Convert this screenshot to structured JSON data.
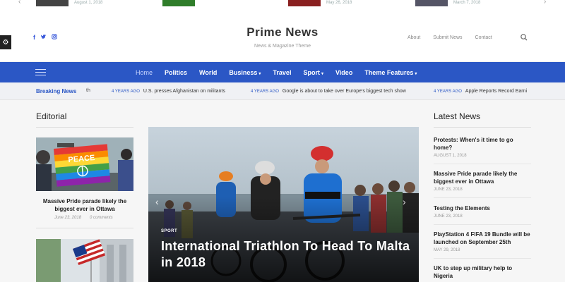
{
  "top_strip": {
    "dates": [
      "August 1, 2018",
      "May 26, 2018",
      "March 7, 2018"
    ]
  },
  "header": {
    "site_title": "Prime News",
    "tagline": "News & Magazine Theme",
    "links": [
      "About",
      "Submit News",
      "Contact"
    ]
  },
  "nav": {
    "items": [
      {
        "label": "Home",
        "caret": ""
      },
      {
        "label": "Politics",
        "caret": ""
      },
      {
        "label": "World",
        "caret": ""
      },
      {
        "label": "Business",
        "caret": "▾"
      },
      {
        "label": "Travel",
        "caret": ""
      },
      {
        "label": "Sport",
        "caret": "▾"
      },
      {
        "label": "Video",
        "caret": ""
      },
      {
        "label": "Theme Features",
        "caret": "▾"
      }
    ]
  },
  "ticker": {
    "label": "Breaking News",
    "partial": "th",
    "items": [
      {
        "time": "4 YEARS AGO",
        "text": "U.S. presses Afghanistan on militants"
      },
      {
        "time": "4 YEARS AGO",
        "text": "Google is about to take over Europe's biggest tech show"
      },
      {
        "time": "4 YEARS AGO",
        "text": "Apple Reports Record Earni"
      }
    ]
  },
  "editorial": {
    "heading": "Editorial",
    "card": {
      "sign_text": "PEACE",
      "title": "Massive Pride parade likely the biggest ever in Ottawa",
      "date": "June 23, 2018",
      "comments": "0 comments"
    }
  },
  "hero": {
    "category": "SPORT",
    "title": "International Triathlon To Head To Malta in 2018"
  },
  "latest": {
    "heading": "Latest News",
    "items": [
      {
        "title": "Protests: When's it time to go home?",
        "date": "AUGUST 1, 2018"
      },
      {
        "title": "Massive Pride parade likely the biggest ever in Ottawa",
        "date": "JUNE 23, 2018"
      },
      {
        "title": "Testing the Elements",
        "date": "JUNE 23, 2018"
      },
      {
        "title": "PlayStation 4 FIFA 19 Bundle will be launched on September 25th",
        "date": "MAY 29, 2018"
      },
      {
        "title": "UK to step up military help to Nigeria",
        "date": ""
      }
    ]
  },
  "colors": {
    "accent": "#2b57c5",
    "nav_bg": "#2b57c5",
    "ticker_bg": "#f0f1f4"
  }
}
